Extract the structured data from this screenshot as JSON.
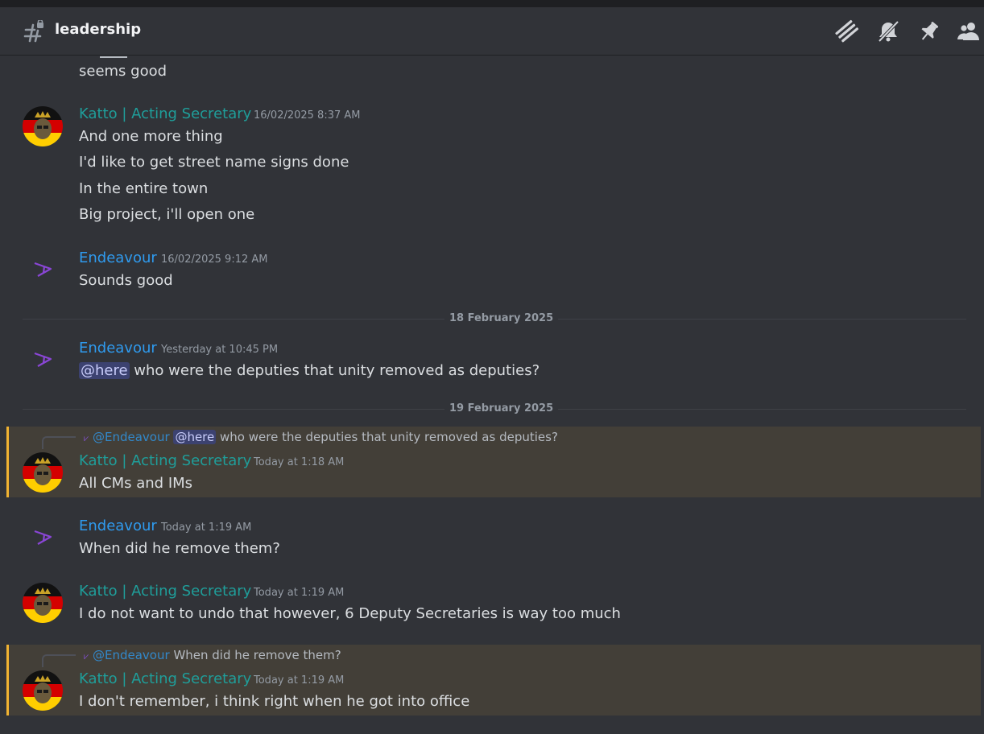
{
  "channel": {
    "name": "leadership"
  },
  "header_icons": [
    "threads-icon",
    "notifications-muted-icon",
    "pin-icon",
    "members-icon"
  ],
  "colors": {
    "katto_role": "#1f9e9a",
    "endeavour_name": "#2f9bef",
    "highlight_bg": "#433f38",
    "highlight_bar": "#f0b232"
  },
  "messages": [
    {
      "lines": [
        "seems good"
      ]
    },
    {
      "author": "Katto | Acting Secretary",
      "timestamp": "16/02/2025 8:37 AM",
      "lines": [
        "And one more thing",
        "I'd like to get street name signs done",
        "In the entire town",
        "Big project, i'll open one"
      ]
    },
    {
      "author": "Endeavour",
      "timestamp": "16/02/2025 9:12 AM",
      "lines": [
        "Sounds good"
      ]
    },
    {
      "author": "Endeavour",
      "timestamp": "Yesterday at 10:45 PM",
      "mention": "@here",
      "text": "who were the deputies that unity removed as deputies?"
    },
    {
      "author": "Katto | Acting Secretary",
      "timestamp": "Today at 1:18 AM",
      "reply": {
        "author": "@Endeavour",
        "mention": "@here",
        "text": "who were the deputies that unity removed as deputies?"
      },
      "lines": [
        "All CMs and IMs"
      ]
    },
    {
      "author": "Endeavour",
      "timestamp": "Today at 1:19 AM",
      "lines": [
        "When did he remove them?"
      ]
    },
    {
      "author": "Katto | Acting Secretary",
      "timestamp": "Today at 1:19 AM",
      "lines": [
        "I do not want to undo that however, 6 Deputy Secretaries is way too much"
      ]
    },
    {
      "author": "Katto | Acting Secretary",
      "timestamp": "Today at 1:19 AM",
      "reply": {
        "author": "@Endeavour",
        "text": "When did he remove them?"
      },
      "lines": [
        "I don't remember, i think right when he got into office"
      ]
    }
  ],
  "dividers": [
    "18 February 2025",
    "19 February 2025"
  ]
}
